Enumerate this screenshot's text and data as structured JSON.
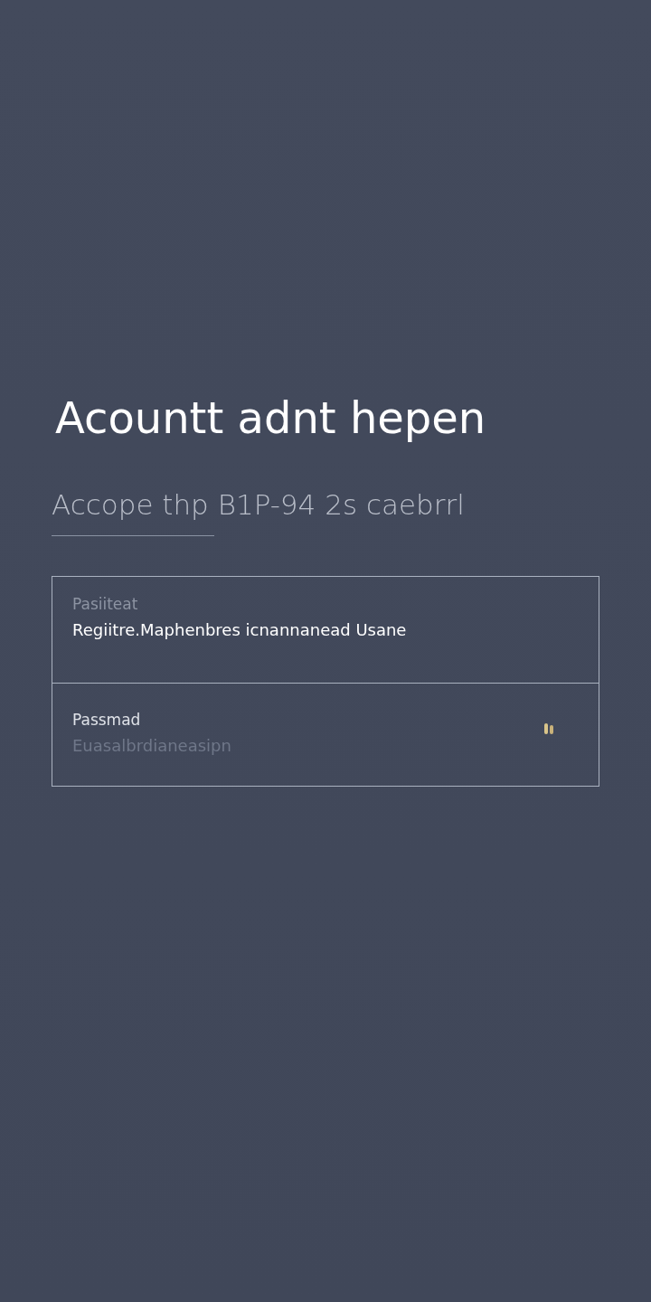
{
  "title": "Acountt adnt hepen",
  "subtitle": "Accope thp B1P-94 2s caebrrl",
  "fields": [
    {
      "label": "Pasiiteat",
      "value": "Regiitre.Maphenbres icnannanead Usane"
    },
    {
      "label": "Passmad",
      "placeholder": "Euasalbrdianeasipn"
    }
  ]
}
